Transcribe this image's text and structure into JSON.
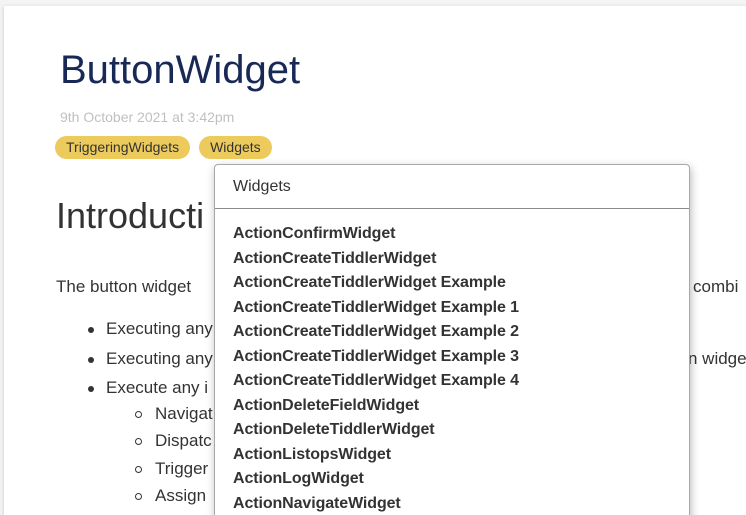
{
  "tiddler": {
    "title": "ButtonWidget",
    "subtitle": "9th October 2021 at 3:42pm",
    "tags": [
      "TriggeringWidgets",
      "Widgets"
    ]
  },
  "content": {
    "heading": "Introducti",
    "paragraph_left": "The button widget",
    "paragraph_right": "combi",
    "bullets": [
      {
        "text": "Executing any"
      },
      {
        "text": "Executing any",
        "right": "n widge"
      },
      {
        "text": "Execute any i"
      }
    ],
    "sub_bullets": [
      "Navigat",
      "Dispatc",
      "Trigger",
      "Assign"
    ]
  },
  "popup": {
    "heading": "Widgets",
    "items": [
      "ActionConfirmWidget",
      "ActionCreateTiddlerWidget",
      "ActionCreateTiddlerWidget Example",
      "ActionCreateTiddlerWidget Example 1",
      "ActionCreateTiddlerWidget Example 2",
      "ActionCreateTiddlerWidget Example 3",
      "ActionCreateTiddlerWidget Example 4",
      "ActionDeleteFieldWidget",
      "ActionDeleteTiddlerWidget",
      "ActionListopsWidget",
      "ActionLogWidget",
      "ActionNavigateWidget"
    ]
  },
  "colors": {
    "title": "#182955",
    "tag_background": "#ecca5b",
    "subtitle": "#c0c0c0",
    "text": "#333333"
  }
}
